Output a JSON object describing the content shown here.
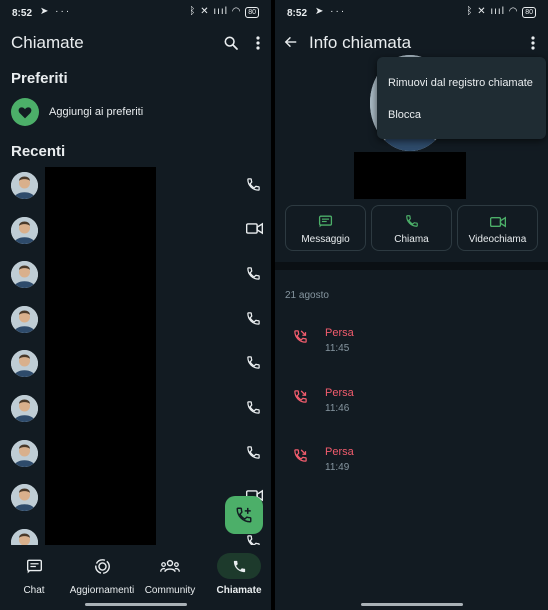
{
  "left": {
    "status_time": "8:52",
    "status_left_icons": "➤ ···",
    "status_right_icons": "ᛒ ✕ ıııl ◠",
    "battery": "80",
    "title": "Chiamate",
    "favorites_title": "Preferiti",
    "add_favorites_label": "Aggiungi ai preferiti",
    "recents_title": "Recenti",
    "recent_call_types": [
      "voice",
      "video",
      "voice",
      "voice",
      "voice",
      "voice",
      "voice",
      "video",
      "voice"
    ],
    "nav": [
      {
        "label": "Chat",
        "icon": "chat-icon"
      },
      {
        "label": "Aggiornamenti",
        "icon": "updates-icon"
      },
      {
        "label": "Community",
        "icon": "community-icon"
      },
      {
        "label": "Chiamate",
        "icon": "phone-icon"
      }
    ]
  },
  "right": {
    "status_time": "8:52",
    "status_left_icons": "➤ ···",
    "status_right_icons": "ᛒ ✕ ıııl ◠",
    "battery": "80",
    "title": "Info chiamata",
    "menu": {
      "remove_label": "Rimuovi dal registro chiamate",
      "block_label": "Blocca"
    },
    "actions": [
      {
        "label": "Messaggio",
        "icon": "message-icon"
      },
      {
        "label": "Chiama",
        "icon": "phone-icon"
      },
      {
        "label": "Videochiama",
        "icon": "video-icon"
      }
    ],
    "date": "21 agosto",
    "calls": [
      {
        "status": "Persa",
        "time": "11:45"
      },
      {
        "status": "Persa",
        "time": "11:46"
      },
      {
        "status": "Persa",
        "time": "11:49"
      }
    ]
  },
  "colors": {
    "accent": "#4caf69",
    "missed": "#f15c6d",
    "background": "#121b22"
  }
}
